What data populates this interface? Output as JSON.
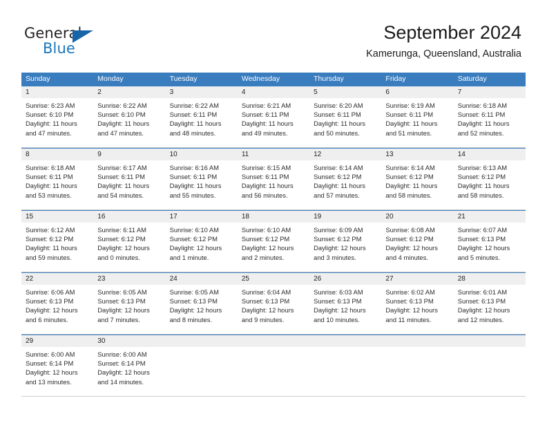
{
  "brand": {
    "name_part1": "General",
    "name_part2": "Blue",
    "triangle_color": "#1565a8",
    "blue_color": "#1b75bb"
  },
  "header": {
    "title": "September 2024",
    "subtitle": "Kamerunga, Queensland, Australia"
  },
  "theme": {
    "header_bg": "#3a7dbf",
    "daynum_bg": "#efefef",
    "cell_bg": "#ffffff",
    "row_divider": "#cccccc",
    "text": "#2b2b2b"
  },
  "weekdays": [
    "Sunday",
    "Monday",
    "Tuesday",
    "Wednesday",
    "Thursday",
    "Friday",
    "Saturday"
  ],
  "weeks": [
    {
      "days": [
        {
          "num": "1",
          "sunrise": "Sunrise: 6:23 AM",
          "sunset": "Sunset: 6:10 PM",
          "daylight1": "Daylight: 11 hours",
          "daylight2": "and 47 minutes."
        },
        {
          "num": "2",
          "sunrise": "Sunrise: 6:22 AM",
          "sunset": "Sunset: 6:10 PM",
          "daylight1": "Daylight: 11 hours",
          "daylight2": "and 47 minutes."
        },
        {
          "num": "3",
          "sunrise": "Sunrise: 6:22 AM",
          "sunset": "Sunset: 6:11 PM",
          "daylight1": "Daylight: 11 hours",
          "daylight2": "and 48 minutes."
        },
        {
          "num": "4",
          "sunrise": "Sunrise: 6:21 AM",
          "sunset": "Sunset: 6:11 PM",
          "daylight1": "Daylight: 11 hours",
          "daylight2": "and 49 minutes."
        },
        {
          "num": "5",
          "sunrise": "Sunrise: 6:20 AM",
          "sunset": "Sunset: 6:11 PM",
          "daylight1": "Daylight: 11 hours",
          "daylight2": "and 50 minutes."
        },
        {
          "num": "6",
          "sunrise": "Sunrise: 6:19 AM",
          "sunset": "Sunset: 6:11 PM",
          "daylight1": "Daylight: 11 hours",
          "daylight2": "and 51 minutes."
        },
        {
          "num": "7",
          "sunrise": "Sunrise: 6:18 AM",
          "sunset": "Sunset: 6:11 PM",
          "daylight1": "Daylight: 11 hours",
          "daylight2": "and 52 minutes."
        }
      ]
    },
    {
      "days": [
        {
          "num": "8",
          "sunrise": "Sunrise: 6:18 AM",
          "sunset": "Sunset: 6:11 PM",
          "daylight1": "Daylight: 11 hours",
          "daylight2": "and 53 minutes."
        },
        {
          "num": "9",
          "sunrise": "Sunrise: 6:17 AM",
          "sunset": "Sunset: 6:11 PM",
          "daylight1": "Daylight: 11 hours",
          "daylight2": "and 54 minutes."
        },
        {
          "num": "10",
          "sunrise": "Sunrise: 6:16 AM",
          "sunset": "Sunset: 6:11 PM",
          "daylight1": "Daylight: 11 hours",
          "daylight2": "and 55 minutes."
        },
        {
          "num": "11",
          "sunrise": "Sunrise: 6:15 AM",
          "sunset": "Sunset: 6:11 PM",
          "daylight1": "Daylight: 11 hours",
          "daylight2": "and 56 minutes."
        },
        {
          "num": "12",
          "sunrise": "Sunrise: 6:14 AM",
          "sunset": "Sunset: 6:12 PM",
          "daylight1": "Daylight: 11 hours",
          "daylight2": "and 57 minutes."
        },
        {
          "num": "13",
          "sunrise": "Sunrise: 6:14 AM",
          "sunset": "Sunset: 6:12 PM",
          "daylight1": "Daylight: 11 hours",
          "daylight2": "and 58 minutes."
        },
        {
          "num": "14",
          "sunrise": "Sunrise: 6:13 AM",
          "sunset": "Sunset: 6:12 PM",
          "daylight1": "Daylight: 11 hours",
          "daylight2": "and 58 minutes."
        }
      ]
    },
    {
      "days": [
        {
          "num": "15",
          "sunrise": "Sunrise: 6:12 AM",
          "sunset": "Sunset: 6:12 PM",
          "daylight1": "Daylight: 11 hours",
          "daylight2": "and 59 minutes."
        },
        {
          "num": "16",
          "sunrise": "Sunrise: 6:11 AM",
          "sunset": "Sunset: 6:12 PM",
          "daylight1": "Daylight: 12 hours",
          "daylight2": "and 0 minutes."
        },
        {
          "num": "17",
          "sunrise": "Sunrise: 6:10 AM",
          "sunset": "Sunset: 6:12 PM",
          "daylight1": "Daylight: 12 hours",
          "daylight2": "and 1 minute."
        },
        {
          "num": "18",
          "sunrise": "Sunrise: 6:10 AM",
          "sunset": "Sunset: 6:12 PM",
          "daylight1": "Daylight: 12 hours",
          "daylight2": "and 2 minutes."
        },
        {
          "num": "19",
          "sunrise": "Sunrise: 6:09 AM",
          "sunset": "Sunset: 6:12 PM",
          "daylight1": "Daylight: 12 hours",
          "daylight2": "and 3 minutes."
        },
        {
          "num": "20",
          "sunrise": "Sunrise: 6:08 AM",
          "sunset": "Sunset: 6:12 PM",
          "daylight1": "Daylight: 12 hours",
          "daylight2": "and 4 minutes."
        },
        {
          "num": "21",
          "sunrise": "Sunrise: 6:07 AM",
          "sunset": "Sunset: 6:13 PM",
          "daylight1": "Daylight: 12 hours",
          "daylight2": "and 5 minutes."
        }
      ]
    },
    {
      "days": [
        {
          "num": "22",
          "sunrise": "Sunrise: 6:06 AM",
          "sunset": "Sunset: 6:13 PM",
          "daylight1": "Daylight: 12 hours",
          "daylight2": "and 6 minutes."
        },
        {
          "num": "23",
          "sunrise": "Sunrise: 6:05 AM",
          "sunset": "Sunset: 6:13 PM",
          "daylight1": "Daylight: 12 hours",
          "daylight2": "and 7 minutes."
        },
        {
          "num": "24",
          "sunrise": "Sunrise: 6:05 AM",
          "sunset": "Sunset: 6:13 PM",
          "daylight1": "Daylight: 12 hours",
          "daylight2": "and 8 minutes."
        },
        {
          "num": "25",
          "sunrise": "Sunrise: 6:04 AM",
          "sunset": "Sunset: 6:13 PM",
          "daylight1": "Daylight: 12 hours",
          "daylight2": "and 9 minutes."
        },
        {
          "num": "26",
          "sunrise": "Sunrise: 6:03 AM",
          "sunset": "Sunset: 6:13 PM",
          "daylight1": "Daylight: 12 hours",
          "daylight2": "and 10 minutes."
        },
        {
          "num": "27",
          "sunrise": "Sunrise: 6:02 AM",
          "sunset": "Sunset: 6:13 PM",
          "daylight1": "Daylight: 12 hours",
          "daylight2": "and 11 minutes."
        },
        {
          "num": "28",
          "sunrise": "Sunrise: 6:01 AM",
          "sunset": "Sunset: 6:13 PM",
          "daylight1": "Daylight: 12 hours",
          "daylight2": "and 12 minutes."
        }
      ]
    },
    {
      "days": [
        {
          "num": "29",
          "sunrise": "Sunrise: 6:00 AM",
          "sunset": "Sunset: 6:14 PM",
          "daylight1": "Daylight: 12 hours",
          "daylight2": "and 13 minutes."
        },
        {
          "num": "30",
          "sunrise": "Sunrise: 6:00 AM",
          "sunset": "Sunset: 6:14 PM",
          "daylight1": "Daylight: 12 hours",
          "daylight2": "and 14 minutes."
        },
        {
          "num": "",
          "sunrise": "",
          "sunset": "",
          "daylight1": "",
          "daylight2": ""
        },
        {
          "num": "",
          "sunrise": "",
          "sunset": "",
          "daylight1": "",
          "daylight2": ""
        },
        {
          "num": "",
          "sunrise": "",
          "sunset": "",
          "daylight1": "",
          "daylight2": ""
        },
        {
          "num": "",
          "sunrise": "",
          "sunset": "",
          "daylight1": "",
          "daylight2": ""
        },
        {
          "num": "",
          "sunrise": "",
          "sunset": "",
          "daylight1": "",
          "daylight2": ""
        }
      ]
    }
  ]
}
